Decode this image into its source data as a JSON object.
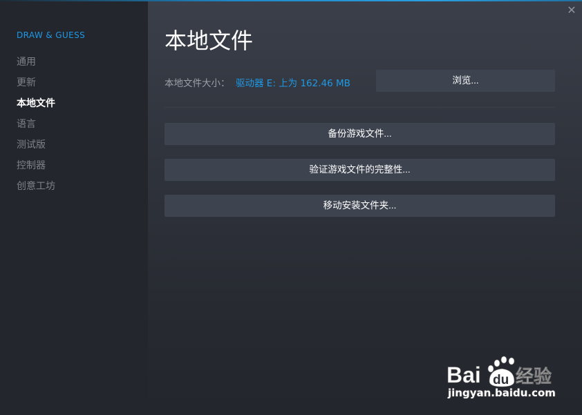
{
  "window": {
    "close_glyph": "✕",
    "close_icon": "close-icon",
    "accent_color": "#1e99e6"
  },
  "sidebar": {
    "app_title": "DRAW & GUESS",
    "items": [
      {
        "label": "通用",
        "active": false
      },
      {
        "label": "更新",
        "active": false
      },
      {
        "label": "本地文件",
        "active": true
      },
      {
        "label": "语言",
        "active": false
      },
      {
        "label": "测试版",
        "active": false
      },
      {
        "label": "控制器",
        "active": false
      },
      {
        "label": "创意工坊",
        "active": false
      }
    ]
  },
  "main": {
    "title": "本地文件",
    "size_label": "本地文件大小：",
    "size_value": "驱动器 E: 上为 162.46 MB",
    "browse_label": "浏览...",
    "buttons": {
      "backup": "备份游戏文件...",
      "verify": "验证游戏文件的完整性...",
      "move": "移动安装文件夹..."
    }
  },
  "watermark": {
    "brand_latin_a": "Bai",
    "brand_latin_b": "du",
    "brand_cn": "经验",
    "url": "jingyan.baidu.com"
  }
}
